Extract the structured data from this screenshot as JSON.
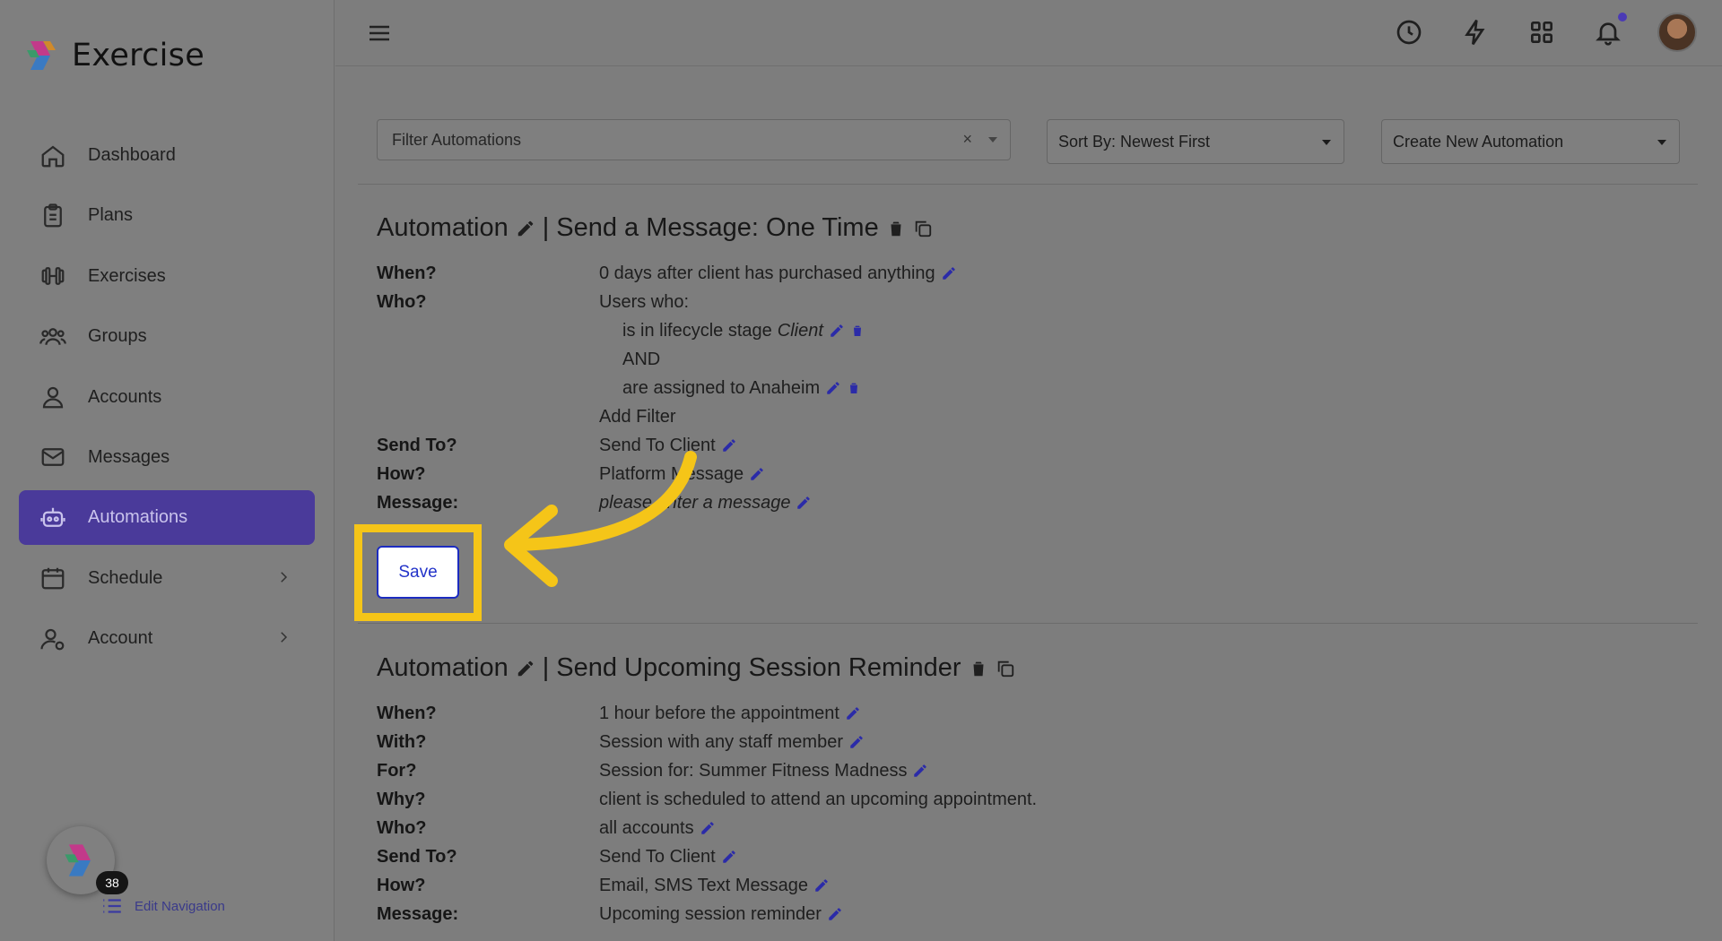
{
  "app": {
    "name": "Exercise"
  },
  "sidebar": {
    "items": [
      {
        "label": "Dashboard",
        "icon": "home-icon",
        "active": false
      },
      {
        "label": "Plans",
        "icon": "clipboard-icon",
        "active": false
      },
      {
        "label": "Exercises",
        "icon": "dumbbell-icon",
        "active": false
      },
      {
        "label": "Groups",
        "icon": "users-icon",
        "active": false
      },
      {
        "label": "Accounts",
        "icon": "user-icon",
        "active": false
      },
      {
        "label": "Messages",
        "icon": "envelope-icon",
        "active": false
      },
      {
        "label": "Automations",
        "icon": "robot-icon",
        "active": true
      },
      {
        "label": "Schedule",
        "icon": "calendar-icon",
        "active": false,
        "has_submenu": true
      },
      {
        "label": "Account",
        "icon": "user-cog-icon",
        "active": false,
        "has_submenu": true
      }
    ],
    "widget_badge": "38",
    "edit_navigation": "Edit Navigation"
  },
  "topbar": {
    "icons": [
      "clock-icon",
      "bolt-icon",
      "grid-icon",
      "bell-icon"
    ],
    "has_notification": true
  },
  "filters": {
    "filter_placeholder": "Filter Automations",
    "clear": "×",
    "sort_value": "Sort By: Newest First",
    "create_value": "Create New Automation"
  },
  "automation1": {
    "title_prefix": "Automation",
    "title_sep": "|",
    "title": "Send a Message: One Time",
    "when_label": "When?",
    "when_value": "0 days after client has purchased anything",
    "who_label": "Who?",
    "who_value": "Users who:",
    "cond1_prefix": "is in lifecycle stage",
    "cond1_stage": "Client",
    "and_label": "AND",
    "cond2": "are assigned to Anaheim",
    "add_filter": "Add Filter",
    "sendto_label": "Send To?",
    "sendto_value": "Send To Client",
    "how_label": "How?",
    "how_value": "Platform Message",
    "message_label": "Message:",
    "message_value": "please enter a message",
    "save": "Save"
  },
  "automation2": {
    "title_prefix": "Automation",
    "title_sep": "|",
    "title": "Send Upcoming Session Reminder",
    "when_label": "When?",
    "when_value": "1 hour before the appointment",
    "with_label": "With?",
    "with_value": "Session with any staff member",
    "for_label": "For?",
    "for_value": "Session for: Summer Fitness Madness",
    "why_label": "Why?",
    "why_value": "client is scheduled to attend an upcoming appointment.",
    "who_label": "Who?",
    "who_value": "all accounts",
    "sendto_label": "Send To?",
    "sendto_value": "Send To Client",
    "how_label": "How?",
    "how_value": "Email, SMS Text Message",
    "message_label": "Message:",
    "message_value": "Upcoming session reminder"
  },
  "colors": {
    "highlight": "#f5c518",
    "accent": "#4a3a9a",
    "link": "#2b32b0"
  }
}
